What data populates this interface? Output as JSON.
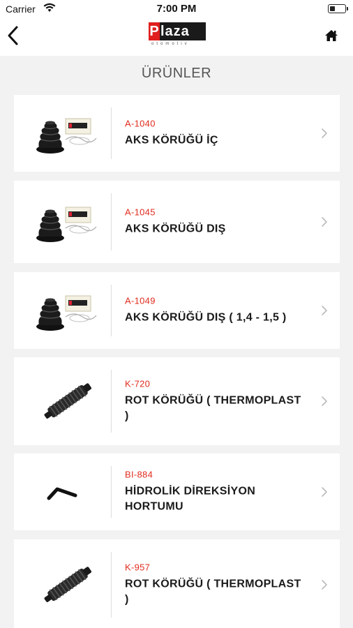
{
  "status_bar": {
    "carrier": "Carrier",
    "time": "7:00 PM"
  },
  "nav": {
    "logo_main": "Plaza",
    "logo_initial": "P",
    "logo_rest": "laza",
    "logo_sub": "otomotiv"
  },
  "page_title": "ÜRÜNLER",
  "products": [
    {
      "code": "A-1040",
      "name": "AKS KÖRÜĞÜ İÇ",
      "image": "cv-boot-with-kit"
    },
    {
      "code": "A-1045",
      "name": "AKS KÖRÜĞÜ DIŞ",
      "image": "cv-boot-with-kit"
    },
    {
      "code": "A-1049",
      "name": "AKS KÖRÜĞÜ DIŞ ( 1,4 - 1,5 )",
      "image": "cv-boot-with-kit"
    },
    {
      "code": "K-720",
      "name": "ROT KÖRÜĞÜ ( THERMOPLAST )",
      "image": "steering-rack-boot"
    },
    {
      "code": "BI-884",
      "name": "HİDROLİK DİREKSİYON HORTUMU",
      "image": "hydraulic-hose"
    },
    {
      "code": "K-957",
      "name": "ROT KÖRÜĞÜ ( THERMOPLAST )",
      "image": "steering-rack-boot"
    }
  ],
  "colors": {
    "accent": "#e02c1e",
    "background": "#f2f2f2"
  },
  "icons": [
    "wifi-icon",
    "battery-icon",
    "back-chevron-icon",
    "home-icon",
    "chevron-right-icon"
  ]
}
